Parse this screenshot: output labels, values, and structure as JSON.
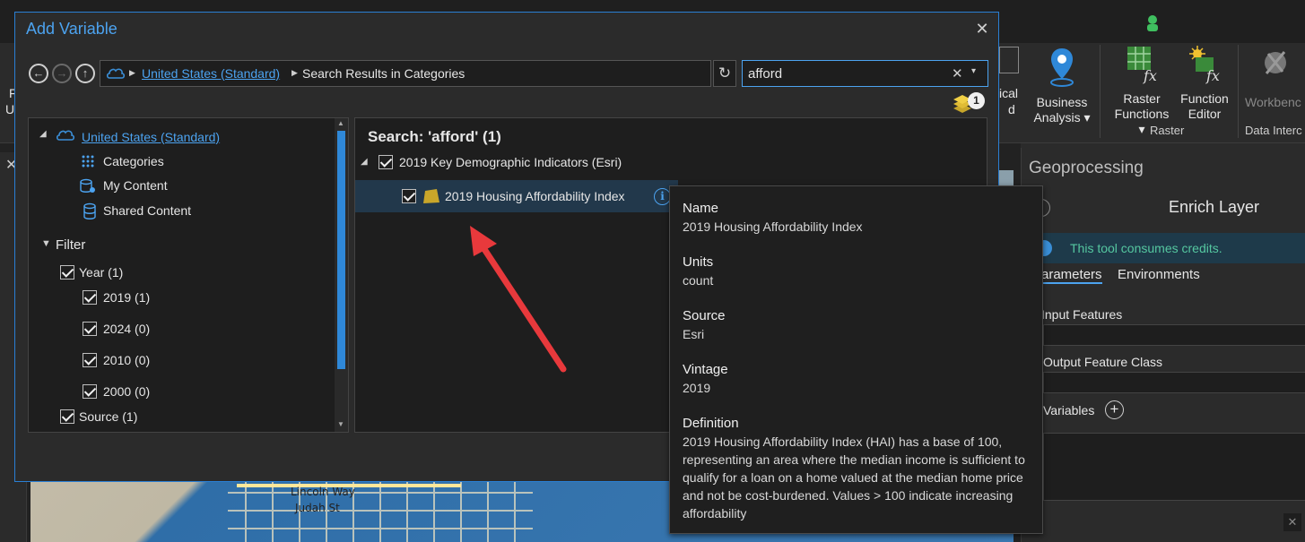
{
  "dialog": {
    "title": "Add Variable",
    "breadcrumb": {
      "root_link": "United States (Standard)",
      "current": "Search Results in Categories"
    },
    "search": {
      "value": "afford"
    },
    "layers_badge": "1",
    "tree": {
      "root": "United States (Standard)",
      "items": [
        "Categories",
        "My Content",
        "Shared Content"
      ],
      "filter_label": "Filter",
      "year_label": "Year (1)",
      "years": [
        "2019 (1)",
        "2024 (0)",
        "2010 (0)",
        "2000 (0)"
      ],
      "source_label": "Source (1)"
    },
    "results": {
      "heading": "Search: 'afford' (1)",
      "category": "2019 Key Demographic Indicators (Esri)",
      "variable": "2019 Housing Affordability Index"
    }
  },
  "tooltip": {
    "name_label": "Name",
    "name_value": "2019 Housing Affordability Index",
    "units_label": "Units",
    "units_value": "count",
    "source_label": "Source",
    "source_value": "Esri",
    "vintage_label": "Vintage",
    "vintage_value": "2019",
    "definition_label": "Definition",
    "definition_value": "2019 Housing Affordability Index (HAI) has a base of 100, representing an area where the median income is sufficient to qualify for a loan on a home valued at the median home price and not be cost-burdened. Values > 100 indicate increasing affordability"
  },
  "ribbon": {
    "partial_left_1": "F",
    "partial_left_2": "U",
    "analytical_1": "ical",
    "analytical_2": "d",
    "business_analysis": [
      "Business",
      "Analysis"
    ],
    "raster_functions": [
      "Raster",
      "Functions"
    ],
    "function_editor": [
      "Function",
      "Editor"
    ],
    "workbench": "Workbenc",
    "raster_group": "Raster",
    "data_interop_group": "Data Interc"
  },
  "geoprocessing": {
    "pane_title": "Geoprocessing",
    "tool_title": "Enrich Layer",
    "credits_msg": "This tool consumes credits.",
    "tab_parameters": "Parameters",
    "tab_environments": "Environments",
    "input_features": "Input Features",
    "output_feature_class": "Output Feature Class",
    "variables": "Variables"
  },
  "map_labels": [
    "Lincoln Way",
    "Judah St"
  ],
  "colors": {
    "accent": "#4ca3f0",
    "arrow": "#e8393c",
    "credit_msg": "#55c7a0"
  }
}
